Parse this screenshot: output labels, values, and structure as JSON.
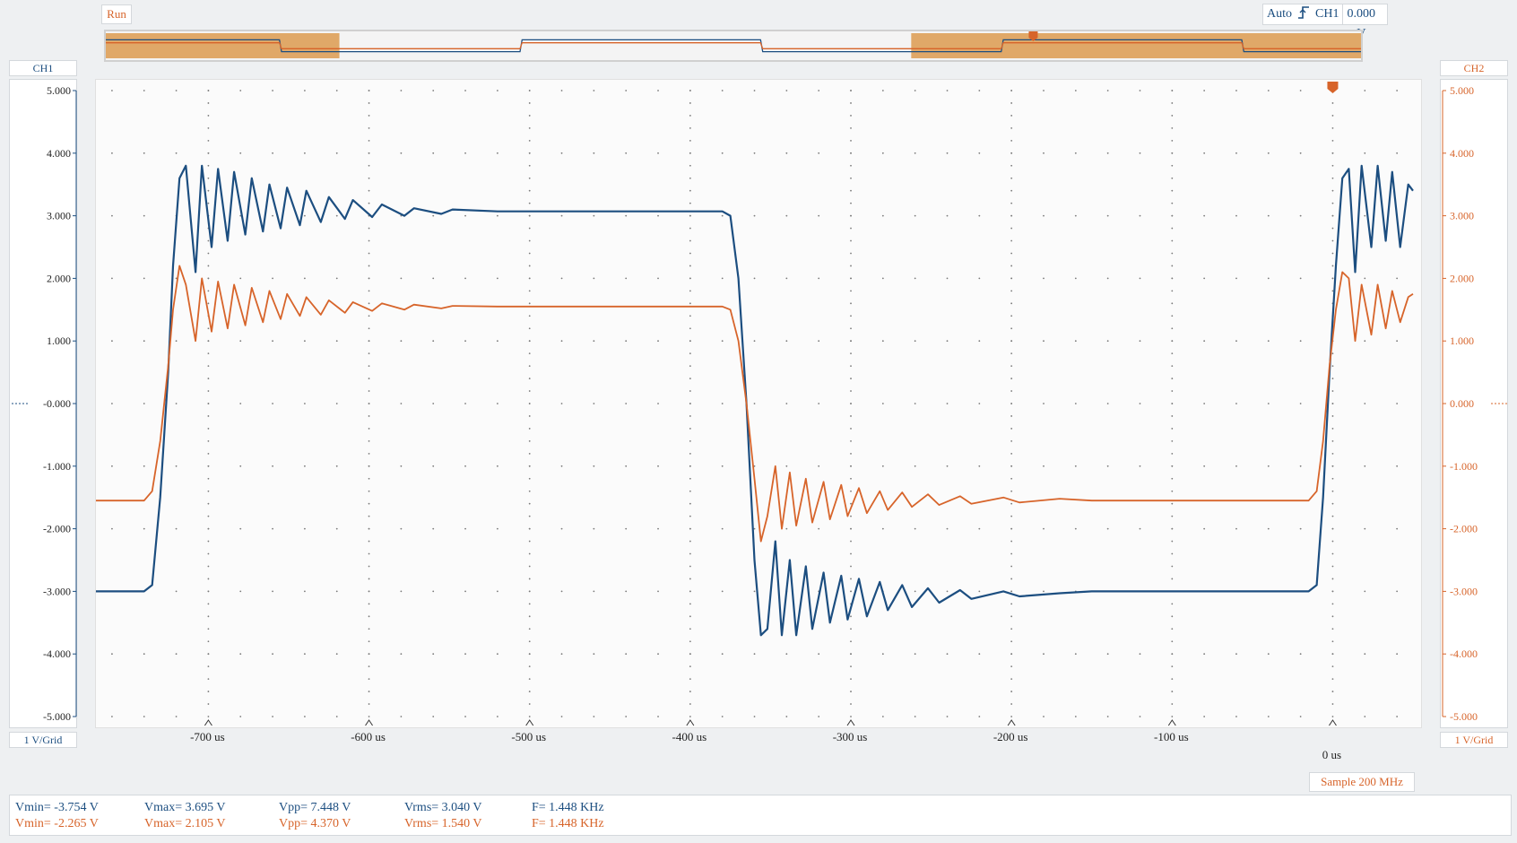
{
  "status": {
    "run_label": "Run"
  },
  "trigger": {
    "mode": "Auto",
    "channel": "CH1",
    "level": "0.000 mV"
  },
  "channels": {
    "ch1": {
      "label": "CH1",
      "scale": "1 V/Grid",
      "color": "#1c4e80"
    },
    "ch2": {
      "label": "CH2",
      "scale": "1 V/Grid",
      "color": "#d7642a"
    }
  },
  "sample_rate": "Sample 200 MHz",
  "measurements": {
    "ch1": {
      "vmin": "Vmin= -3.754 V",
      "vmax": "Vmax= 3.695 V",
      "vpp": "Vpp= 7.448 V",
      "vrms": "Vrms= 3.040 V",
      "freq": "F= 1.448 KHz"
    },
    "ch2": {
      "vmin": "Vmin= -2.265 V",
      "vmax": "Vmax= 2.105 V",
      "vpp": "Vpp= 4.370 V",
      "vrms": "Vrms= 1.540 V",
      "freq": "F= 1.448 KHz"
    }
  },
  "chart_data": {
    "type": "line",
    "x_unit": "us",
    "xlim": [
      -770,
      55
    ],
    "ylim": [
      -5,
      5
    ],
    "x_ticks": [
      -700,
      -600,
      -500,
      -400,
      -300,
      -200,
      -100,
      0
    ],
    "x_tick_labels": [
      "-700 us",
      "-600 us",
      "-500 us",
      "-400 us",
      "-300 us",
      "-200 us",
      "-100 us",
      "0 us"
    ],
    "y_ticks": [
      5,
      4,
      3,
      2,
      1,
      0,
      -1,
      -2,
      -3,
      -4,
      -5
    ],
    "y_tick_labels_left": [
      "5.000",
      "4.000",
      "3.000",
      "2.000",
      "1.000",
      "-0.000",
      "-1.000",
      "-2.000",
      "-3.000",
      "-4.000",
      "-5.000"
    ],
    "y_tick_labels_right": [
      "5.000",
      "4.000",
      "3.000",
      "2.000",
      "1.000",
      "0.000",
      "-1.000",
      "-2.000",
      "-3.000",
      "-4.000",
      "-5.000"
    ],
    "grid": true,
    "series": [
      {
        "name": "CH1",
        "color": "#1c4e80",
        "x": [
          -770,
          -740,
          -735,
          -730,
          -725,
          -722,
          -718,
          -714,
          -708,
          -704,
          -698,
          -694,
          -688,
          -684,
          -677,
          -673,
          -666,
          -662,
          -655,
          -651,
          -643,
          -639,
          -630,
          -625,
          -615,
          -610,
          -598,
          -592,
          -578,
          -572,
          -555,
          -548,
          -520,
          -380,
          -375,
          -370,
          -365,
          -360,
          -356,
          -352,
          -347,
          -343,
          -338,
          -334,
          -328,
          -324,
          -317,
          -313,
          -306,
          -302,
          -295,
          -290,
          -282,
          -277,
          -268,
          -262,
          -252,
          -245,
          -232,
          -225,
          -205,
          -195,
          -170,
          -150,
          -100,
          -50,
          -15,
          -10,
          -6,
          -2,
          2,
          6,
          10,
          14,
          18,
          24,
          28,
          33,
          37,
          42,
          47,
          50
        ],
        "y": [
          -3.0,
          -3.0,
          -2.9,
          -1.5,
          0.5,
          2.2,
          3.6,
          3.8,
          2.1,
          3.8,
          2.5,
          3.75,
          2.6,
          3.7,
          2.7,
          3.6,
          2.75,
          3.5,
          2.8,
          3.45,
          2.85,
          3.4,
          2.9,
          3.3,
          2.95,
          3.25,
          2.98,
          3.18,
          3.0,
          3.12,
          3.03,
          3.1,
          3.07,
          3.07,
          3.0,
          2.0,
          0.0,
          -2.5,
          -3.7,
          -3.6,
          -2.2,
          -3.7,
          -2.5,
          -3.7,
          -2.6,
          -3.6,
          -2.7,
          -3.5,
          -2.75,
          -3.45,
          -2.8,
          -3.4,
          -2.85,
          -3.3,
          -2.9,
          -3.25,
          -2.95,
          -3.18,
          -2.98,
          -3.12,
          -3.0,
          -3.08,
          -3.03,
          -3.0,
          -3.0,
          -3.0,
          -3.0,
          -2.9,
          -1.5,
          0.5,
          2.2,
          3.6,
          3.75,
          2.1,
          3.8,
          2.5,
          3.8,
          2.6,
          3.7,
          2.5,
          3.5,
          3.4
        ]
      },
      {
        "name": "CH2",
        "color": "#d7642a",
        "x": [
          -770,
          -740,
          -735,
          -730,
          -725,
          -722,
          -718,
          -714,
          -708,
          -704,
          -698,
          -694,
          -688,
          -684,
          -677,
          -673,
          -666,
          -662,
          -655,
          -651,
          -643,
          -639,
          -630,
          -625,
          -615,
          -610,
          -598,
          -592,
          -578,
          -572,
          -555,
          -548,
          -520,
          -380,
          -375,
          -370,
          -365,
          -360,
          -356,
          -352,
          -347,
          -343,
          -338,
          -334,
          -328,
          -324,
          -317,
          -313,
          -306,
          -302,
          -295,
          -290,
          -282,
          -277,
          -268,
          -262,
          -252,
          -245,
          -232,
          -225,
          -205,
          -195,
          -170,
          -150,
          -100,
          -50,
          -15,
          -10,
          -6,
          -2,
          2,
          6,
          10,
          14,
          18,
          24,
          28,
          33,
          37,
          42,
          47,
          50
        ],
        "y": [
          -1.55,
          -1.55,
          -1.4,
          -0.6,
          0.6,
          1.5,
          2.2,
          1.9,
          1.0,
          2.0,
          1.15,
          1.95,
          1.2,
          1.9,
          1.25,
          1.85,
          1.3,
          1.8,
          1.35,
          1.75,
          1.4,
          1.7,
          1.42,
          1.65,
          1.45,
          1.62,
          1.48,
          1.6,
          1.5,
          1.58,
          1.52,
          1.56,
          1.55,
          1.55,
          1.5,
          1.0,
          0.0,
          -1.2,
          -2.2,
          -1.8,
          -1.0,
          -2.0,
          -1.1,
          -1.95,
          -1.2,
          -1.9,
          -1.25,
          -1.85,
          -1.3,
          -1.8,
          -1.35,
          -1.75,
          -1.4,
          -1.7,
          -1.42,
          -1.65,
          -1.45,
          -1.62,
          -1.48,
          -1.6,
          -1.5,
          -1.58,
          -1.52,
          -1.55,
          -1.55,
          -1.55,
          -1.55,
          -1.4,
          -0.6,
          0.6,
          1.5,
          2.1,
          2.0,
          1.0,
          1.9,
          1.1,
          1.9,
          1.2,
          1.8,
          1.3,
          1.7,
          1.75
        ]
      }
    ]
  }
}
